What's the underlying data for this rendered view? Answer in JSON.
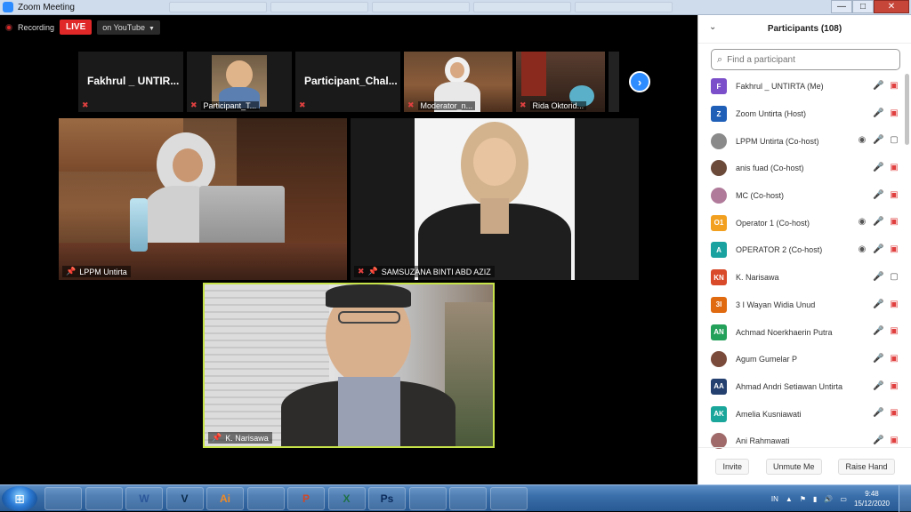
{
  "window": {
    "title": "Zoom Meeting",
    "controls": [
      "—",
      "□",
      "✕"
    ]
  },
  "recording": {
    "label": "Recording",
    "live_label": "LIVE",
    "stream_label": "on YouTube"
  },
  "strip": [
    {
      "name": "Fakhrul _ UNTIR...",
      "label": "",
      "has_video": false
    },
    {
      "name": "",
      "label": "Participant_T...",
      "has_video": true
    },
    {
      "name": "Participant_Chal...",
      "label": "",
      "has_video": false
    },
    {
      "name": "",
      "label": "Moderator_n...",
      "has_video": true
    },
    {
      "name": "",
      "label": "Rida Oktorid...",
      "has_video": true
    }
  ],
  "main_videos": [
    {
      "label": "LPPM Untirta"
    },
    {
      "label": "SAMSUZANA BINTI ABD AZIZ"
    },
    {
      "label": "K. Narisawa"
    }
  ],
  "laptop_logo": "",
  "panel": {
    "title": "Participants (108)",
    "search_placeholder": "Find a participant",
    "participants": [
      {
        "initials": "F",
        "color": "#7b4fc9",
        "name": "Fakhrul _ UNTIRTA (Me)",
        "icons": "mute-video-off"
      },
      {
        "initials": "Z",
        "color": "#1f5fb8",
        "name": "Zoom Untirta (Host)",
        "icons": "mute-video-off"
      },
      {
        "initials": "",
        "color": "#8a8a8a",
        "name": "LPPM Untirta (Co-host)",
        "icons": "record-mic-video"
      },
      {
        "initials": "",
        "color": "#6b4a3a",
        "name": "anis fuad (Co-host)",
        "icons": "mute-video-off"
      },
      {
        "initials": "",
        "color": "#b07a9a",
        "name": "MC (Co-host)",
        "icons": "mute-video-off"
      },
      {
        "initials": "O1",
        "color": "#f2a020",
        "name": "Operator 1 (Co-host)",
        "icons": "record-mute-video-off"
      },
      {
        "initials": "A",
        "color": "#1aa2a0",
        "name": "OPERATOR 2 (Co-host)",
        "icons": "record-mute-video-off"
      },
      {
        "initials": "KN",
        "color": "#d84a2a",
        "name": "K. Narisawa",
        "icons": "mic-video"
      },
      {
        "initials": "3I",
        "color": "#e06a10",
        "name": "3 I Wayan Widia Unud",
        "icons": "mute-video-off"
      },
      {
        "initials": "AN",
        "color": "#23a05a",
        "name": "Achmad Noerkhaerin Putra",
        "icons": "mute-video-off"
      },
      {
        "initials": "",
        "color": "#7a4a3a",
        "name": "Agum Gumelar P",
        "icons": "mute-video-off"
      },
      {
        "initials": "AA",
        "color": "#24406e",
        "name": "Ahmad Andri Setiawan Untirta",
        "icons": "mute-video-off"
      },
      {
        "initials": "AK",
        "color": "#1aa69a",
        "name": "Amelia Kusniawati",
        "icons": "mute-video-off"
      },
      {
        "initials": "",
        "color": "#a06a6a",
        "name": "Ani Rahmawati",
        "icons": "mute-video-off"
      }
    ],
    "footer": {
      "invite": "Invite",
      "unmute": "Unmute Me",
      "raise_hand": "Raise Hand"
    }
  },
  "taskbar": {
    "apps": [
      "",
      "",
      "W",
      "V",
      "Ai",
      "",
      "P",
      "X",
      "Ps",
      "",
      "",
      ""
    ],
    "language": "IN",
    "time": "9:48",
    "date": "15/12/2020"
  }
}
